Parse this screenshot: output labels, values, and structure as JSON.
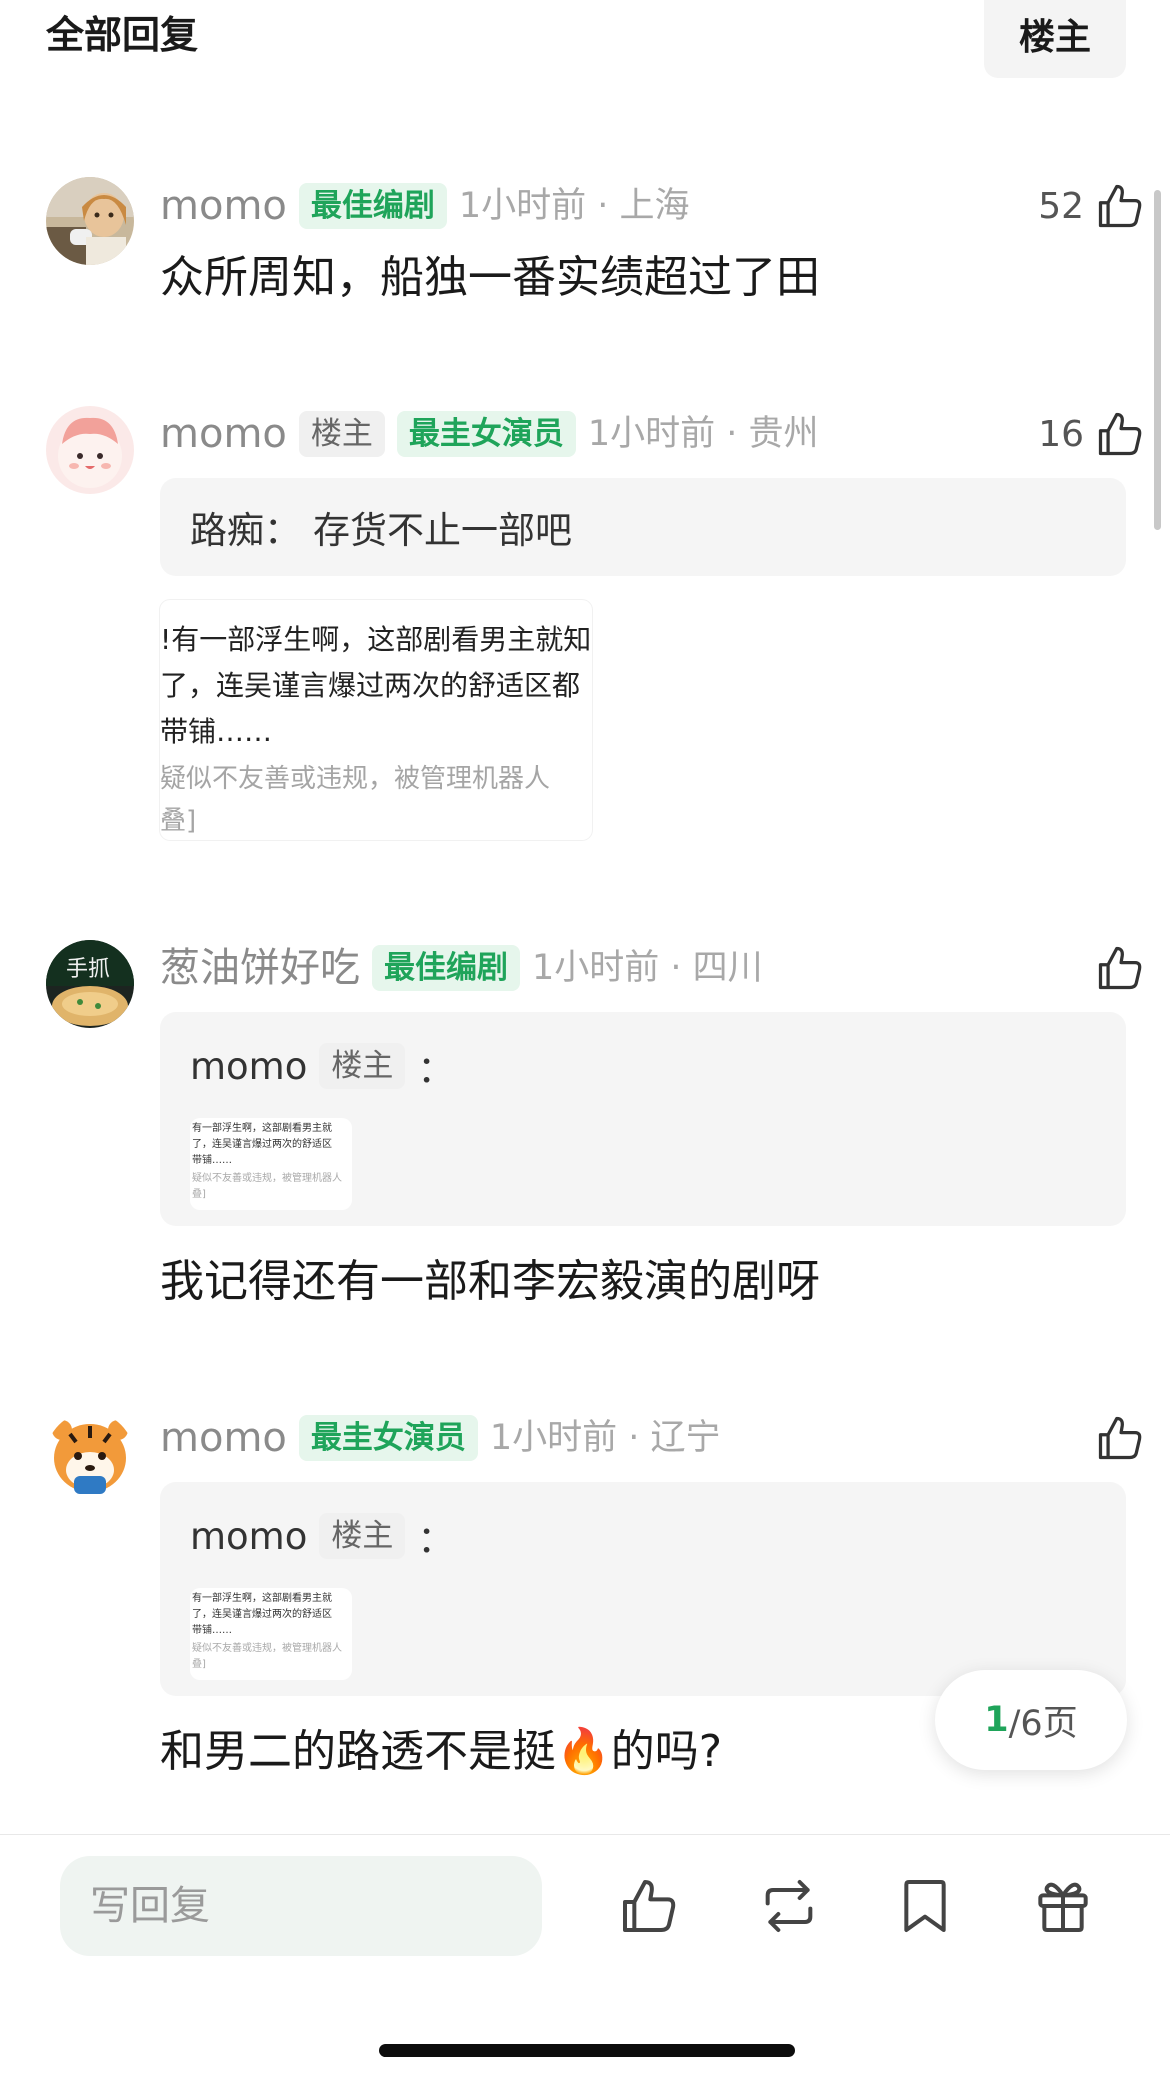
{
  "header": {
    "title": "全部回复",
    "op_filter_label": "楼主"
  },
  "comments": [
    {
      "username": "momo",
      "badges": [
        "最佳编剧"
      ],
      "time_location": "1小时前 · 上海",
      "likes": "52",
      "text": "众所周知，船独一番实绩超过了田",
      "avatar_icon": "girl-photo-avatar"
    },
    {
      "username": "momo",
      "badges": [
        "楼主",
        "最圭女演员"
      ],
      "time_location": "1小时前 · 贵州",
      "likes": "16",
      "quote": {
        "author": "路痴",
        "sep": "：",
        "text": "存货不止一部吧"
      },
      "image_lines": [
        "!有一部浮生啊，这部剧看男主就知",
        "了，连吴谨言爆过两次的舒适区都",
        "带铺……",
        "疑似不友善或违规，被管理机器人",
        "叠]"
      ],
      "avatar_icon": "pink-cartoon-avatar"
    },
    {
      "username": "葱油饼好吃",
      "badges": [
        "最佳编剧"
      ],
      "time_location": "1小时前 · 四川",
      "likes": "",
      "quote": {
        "author": "momo",
        "badge": "楼主",
        "sep": "："
      },
      "mini_image_lines": [
        "有一部浮生啊，这部剧看男主就",
        "了，连吴谨言爆过两次的舒适区",
        "带铺……",
        "疑似不友善或违规，被管理机器人",
        "叠]"
      ],
      "text": "我记得还有一部和李宏毅演的剧呀",
      "avatar_icon": "scallion-pancake-avatar"
    },
    {
      "username": "momo",
      "badges": [
        "最圭女演员"
      ],
      "time_location": "1小时前 · 辽宁",
      "likes": "",
      "quote": {
        "author": "momo",
        "badge": "楼主",
        "sep": "："
      },
      "mini_image_lines": [
        "有一部浮生啊，这部剧看男主就",
        "了，连吴谨言爆过两次的舒适区",
        "带铺……",
        "疑似不友善或违规，被管理机器人",
        "叠]"
      ],
      "text_before": "和男二的路透不是挺",
      "text_emoji": "🔥",
      "text_after": "的吗?",
      "avatar_icon": "tiger-cartoon-avatar"
    }
  ],
  "pagination": {
    "current": "1",
    "total_label": "/6页"
  },
  "bottom_bar": {
    "reply_placeholder": "写回复",
    "icons": [
      "thumbs-up-icon",
      "repost-icon",
      "bookmark-icon",
      "gift-icon"
    ]
  },
  "colors": {
    "accent_green": "#1fa45a",
    "badge_green_bg": "#e6f6ec"
  }
}
